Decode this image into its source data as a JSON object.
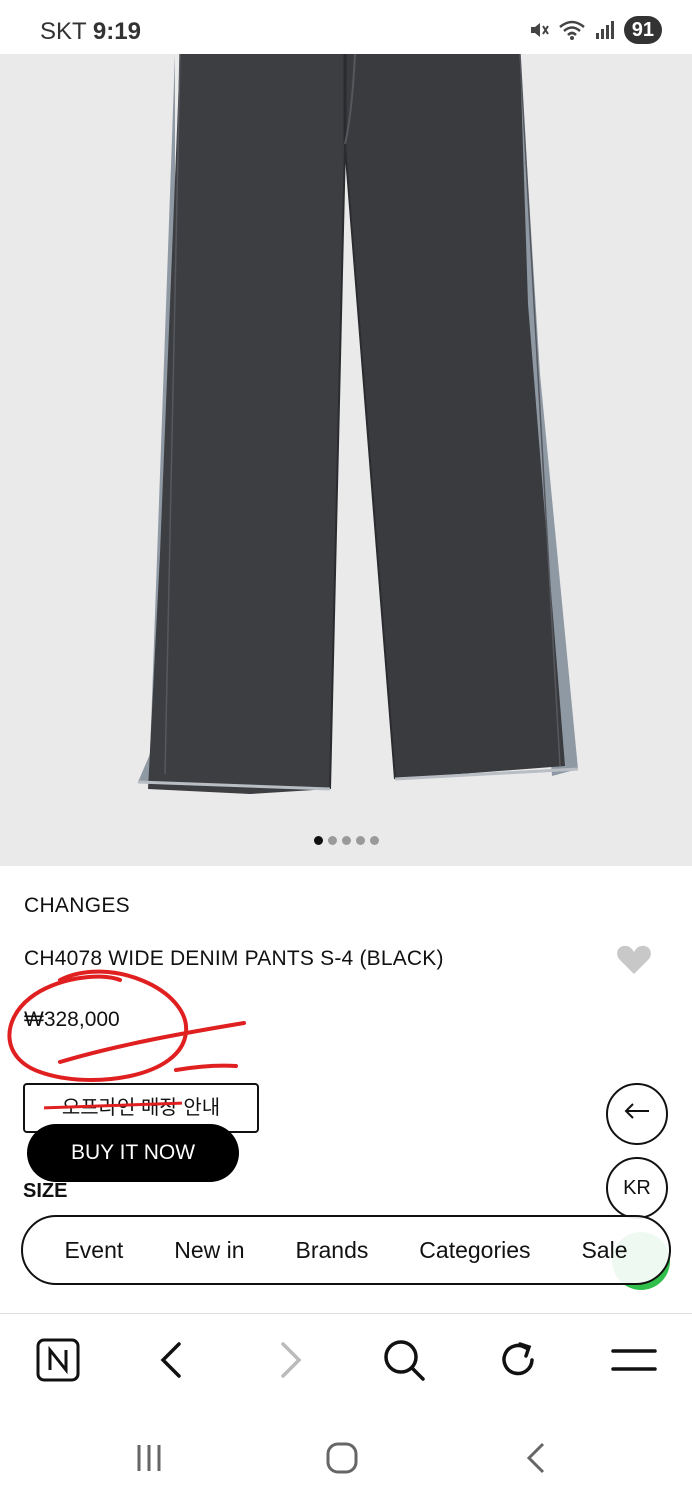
{
  "status_bar": {
    "carrier": "SKT",
    "time": "9:19",
    "battery": "91",
    "icons": [
      "mute-icon",
      "wifi-icon",
      "signal-icon"
    ]
  },
  "carousel": {
    "total_images": 5,
    "active_index": 0
  },
  "product": {
    "brand": "CHANGES",
    "name": "CH4078 WIDE DENIM PANTS S-4 (BLACK)",
    "price": "₩328,000"
  },
  "actions": {
    "store_button": "오프라인 매장 안내",
    "buy_now": "BUY IT NOW",
    "size_label": "SIZE",
    "language": "KR"
  },
  "category_nav": [
    "Event",
    "New in",
    "Brands",
    "Categories",
    "Sale"
  ],
  "browser_toolbar": [
    "naver-home-icon",
    "back-icon",
    "forward-icon",
    "search-icon",
    "reload-icon",
    "menu-icon"
  ],
  "colors": {
    "annotation_red": "#e02020",
    "fab_green": "#2fbf4a",
    "image_background": "#eaeaea"
  }
}
